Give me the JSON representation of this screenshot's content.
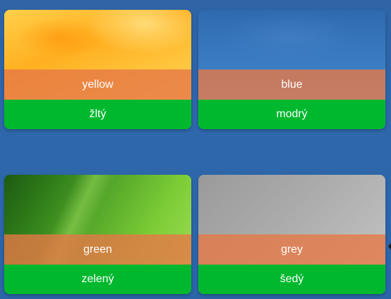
{
  "cards": [
    {
      "word": "yellow",
      "translation": "žltý"
    },
    {
      "word": "blue",
      "translation": "modrý"
    },
    {
      "word": "green",
      "translation": "zelený"
    },
    {
      "word": "grey",
      "translation": "šedý"
    }
  ],
  "colors": {
    "background": "#2e67ab",
    "label_band": "#e6784a",
    "translation_band": "#00b82e",
    "text": "#ffffff"
  }
}
